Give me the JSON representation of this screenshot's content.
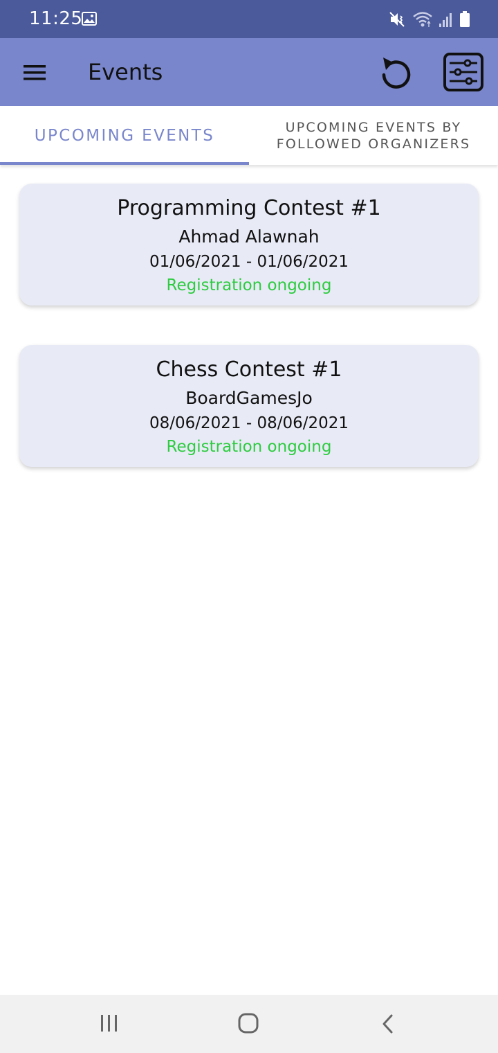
{
  "status_bar": {
    "time": "11:25",
    "icons": [
      "image-icon",
      "mute-vibrate-icon",
      "wifi-icon",
      "signal-icon",
      "battery-icon"
    ]
  },
  "app_bar": {
    "title": "Events",
    "background": "#7986cb",
    "icons": [
      "menu-icon",
      "refresh-icon",
      "filter-icon"
    ]
  },
  "tabs": [
    {
      "label": "UPCOMING EVENTS",
      "active": true
    },
    {
      "label_line1": "UPCOMING EVENTS BY",
      "label_line2": "FOLLOWED ORGANIZERS",
      "active": false
    }
  ],
  "events": [
    {
      "title": "Programming Contest #1",
      "organizer": "Ahmad Alawnah",
      "dates": "01/06/2021 - 01/06/2021",
      "status": "Registration ongoing"
    },
    {
      "title": "Chess Contest #1",
      "organizer": "BoardGamesJo",
      "dates": "08/06/2021 - 08/06/2021",
      "status": "Registration ongoing"
    }
  ],
  "colors": {
    "status_bar": "#4a5a9a",
    "accent": "#7986cb",
    "card_background": "#e8eaf6",
    "status_green": "#2ecc40"
  },
  "nav_bar": {
    "icons": [
      "recents-icon",
      "home-icon",
      "back-icon"
    ]
  }
}
